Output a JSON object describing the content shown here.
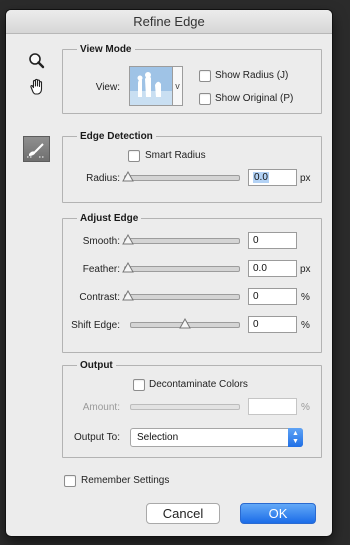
{
  "window": {
    "title": "Refine Edge"
  },
  "tools": [
    {
      "name": "zoom-icon"
    },
    {
      "name": "hand-icon"
    },
    {
      "name": "refine-radius-brush-icon"
    }
  ],
  "view_mode": {
    "legend": "View Mode",
    "view_label": "View:",
    "show_radius": {
      "label": "Show Radius (J)",
      "checked": false
    },
    "show_original": {
      "label": "Show Original (P)",
      "checked": false
    }
  },
  "edge_detection": {
    "legend": "Edge Detection",
    "smart_radius": {
      "label": "Smart Radius",
      "checked": false
    },
    "radius": {
      "label": "Radius:",
      "value": "0.0",
      "unit": "px",
      "slider_fraction": 0.0
    }
  },
  "adjust_edge": {
    "legend": "Adjust Edge",
    "smooth": {
      "label": "Smooth:",
      "value": "0",
      "unit": "",
      "slider_fraction": 0.0
    },
    "feather": {
      "label": "Feather:",
      "value": "0.0",
      "unit": "px",
      "slider_fraction": 0.0
    },
    "contrast": {
      "label": "Contrast:",
      "value": "0",
      "unit": "%",
      "slider_fraction": 0.0
    },
    "shift_edge": {
      "label": "Shift Edge:",
      "value": "0",
      "unit": "%",
      "slider_fraction": 0.5
    }
  },
  "output": {
    "legend": "Output",
    "decontaminate": {
      "label": "Decontaminate Colors",
      "checked": false
    },
    "amount": {
      "label": "Amount:",
      "value": "",
      "unit": "%",
      "enabled": false
    },
    "output_to": {
      "label": "Output To:",
      "selected": "Selection"
    }
  },
  "remember": {
    "label": "Remember Settings",
    "checked": false
  },
  "buttons": {
    "cancel": "Cancel",
    "ok": "OK"
  },
  "colors": {
    "accent": "#1b6ce8",
    "dialog_bg": "#ececec",
    "backdrop": "#2b2b2b"
  }
}
